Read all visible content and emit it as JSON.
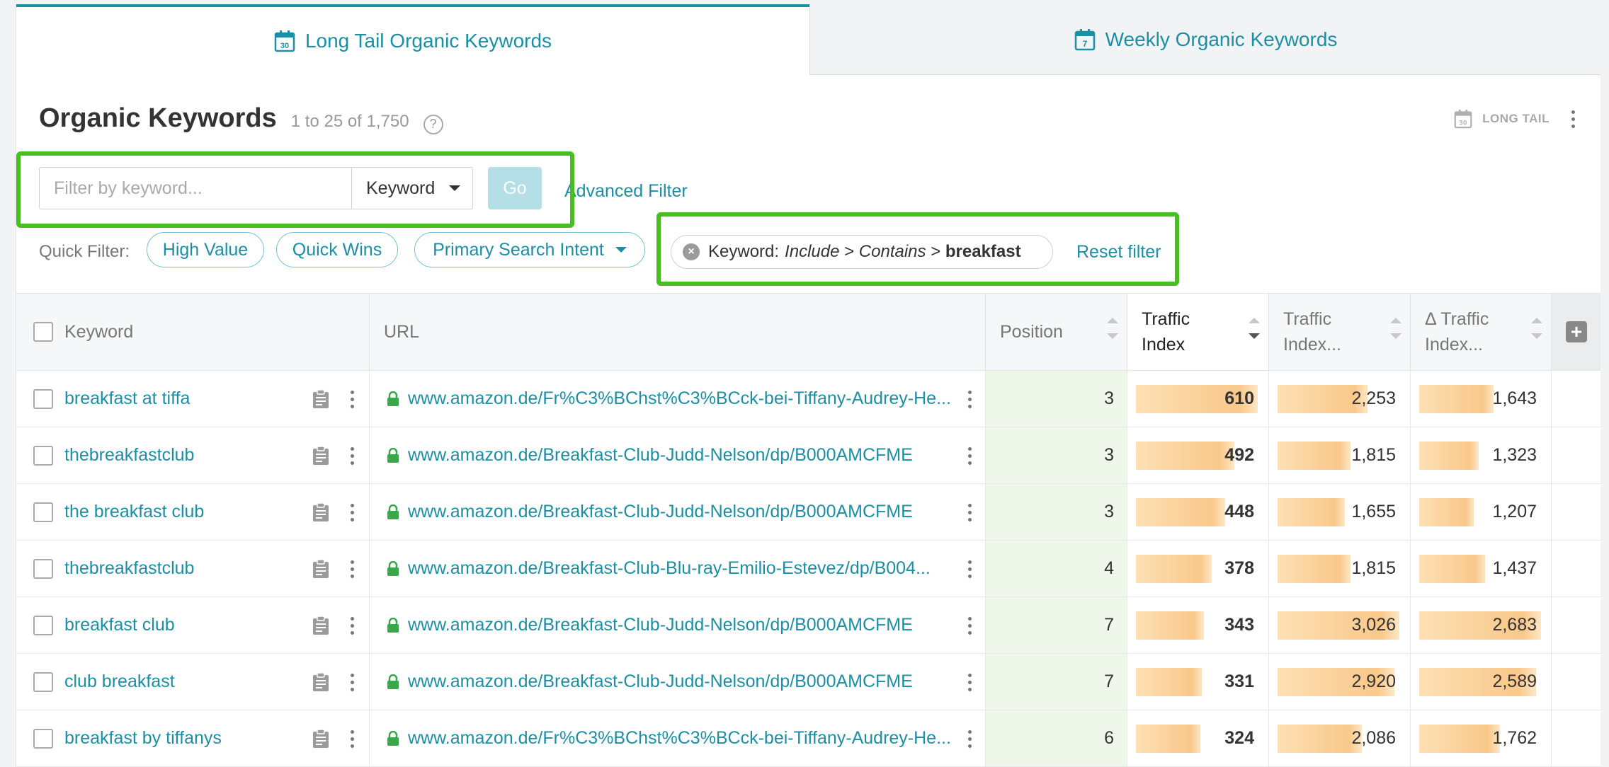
{
  "tabs": [
    {
      "label": "Long Tail Organic Keywords",
      "icon": "calendar-30-icon",
      "day": "30",
      "active": true
    },
    {
      "label": "Weekly Organic Keywords",
      "icon": "calendar-7-icon",
      "day": "7",
      "active": false
    }
  ],
  "header": {
    "title": "Organic Keywords",
    "count": "1 to 25 of 1,750",
    "help": "?",
    "mode_label": "LONG TAIL",
    "mode_day": "30"
  },
  "filter": {
    "placeholder": "Filter by keyword...",
    "type_select": "Keyword",
    "go_label": "Go",
    "advanced_label": "Advanced Filter"
  },
  "quick_filter": {
    "label": "Quick Filter:",
    "pills": [
      "High Value",
      "Quick Wins",
      "Primary Search Intent"
    ]
  },
  "active_filter": {
    "field": "Keyword:",
    "mode": "Include",
    "op": "Contains",
    "value": "breakfast",
    "sep": ">",
    "reset_label": "Reset filter"
  },
  "table": {
    "columns": {
      "keyword": "Keyword",
      "url": "URL",
      "position": "Position",
      "traffic_index_1": "Traffic",
      "traffic_index_2": "Index",
      "traffic_index_ex_1": "Traffic",
      "traffic_index_ex_2": "Index...",
      "delta_1": "Δ Traffic",
      "delta_2": "Index..."
    },
    "rows": [
      {
        "keyword": "breakfast at tiffa",
        "url": "www.amazon.de/Fr%C3%BChst%C3%BCck-bei-Tiffany-Audrey-He...",
        "position": "3",
        "traffic_index": "610",
        "traffic_index_ex": "2,253",
        "delta": "1,643",
        "bars": [
          1.0,
          0.74,
          0.61
        ]
      },
      {
        "keyword": "thebreakfastclub",
        "url": "www.amazon.de/Breakfast-Club-Judd-Nelson/dp/B000AMCFME",
        "position": "3",
        "traffic_index": "492",
        "traffic_index_ex": "1,815",
        "delta": "1,323",
        "bars": [
          0.81,
          0.6,
          0.49
        ]
      },
      {
        "keyword": "the breakfast club",
        "url": "www.amazon.de/Breakfast-Club-Judd-Nelson/dp/B000AMCFME",
        "position": "3",
        "traffic_index": "448",
        "traffic_index_ex": "1,655",
        "delta": "1,207",
        "bars": [
          0.73,
          0.55,
          0.45
        ]
      },
      {
        "keyword": "thebreakfastclub",
        "url": "www.amazon.de/Breakfast-Club-Blu-ray-Emilio-Estevez/dp/B004...",
        "position": "4",
        "traffic_index": "378",
        "traffic_index_ex": "1,815",
        "delta": "1,437",
        "bars": [
          0.62,
          0.6,
          0.54
        ]
      },
      {
        "keyword": "breakfast club",
        "url": "www.amazon.de/Breakfast-Club-Judd-Nelson/dp/B000AMCFME",
        "position": "7",
        "traffic_index": "343",
        "traffic_index_ex": "3,026",
        "delta": "2,683",
        "bars": [
          0.56,
          1.0,
          1.0
        ]
      },
      {
        "keyword": "club breakfast",
        "url": "www.amazon.de/Breakfast-Club-Judd-Nelson/dp/B000AMCFME",
        "position": "7",
        "traffic_index": "331",
        "traffic_index_ex": "2,920",
        "delta": "2,589",
        "bars": [
          0.54,
          0.96,
          0.96
        ]
      },
      {
        "keyword": "breakfast by tiffanys",
        "url": "www.amazon.de/Fr%C3%BChst%C3%BCck-bei-Tiffany-Audrey-He...",
        "position": "6",
        "traffic_index": "324",
        "traffic_index_ex": "2,086",
        "delta": "1,762",
        "bars": [
          0.53,
          0.69,
          0.66
        ]
      }
    ]
  },
  "colors": {
    "accent": "#1a8fa6",
    "highlight": "#47c01f",
    "bar": "#f9c88a",
    "position_bg": "#eff7ea"
  }
}
